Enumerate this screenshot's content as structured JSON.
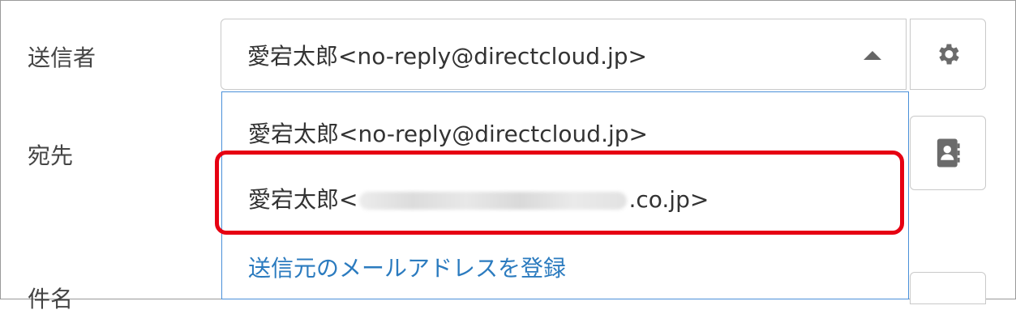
{
  "sender": {
    "label": "送信者",
    "selected": "愛宕太郎<no-reply@directcloud.jp>"
  },
  "recipient": {
    "label": "宛先"
  },
  "subject": {
    "label": "件名"
  },
  "dropdown": {
    "options": [
      {
        "text": "愛宕太郎<no-reply@directcloud.jp>"
      },
      {
        "prefix": "愛宕太郎<",
        "suffix": ".co.jp>"
      }
    ],
    "register_link": "送信元のメールアドレスを登録"
  },
  "colors": {
    "highlight": "#e60012",
    "link": "#2b7bbf",
    "focus_border": "#4a90d9"
  },
  "icons": {
    "settings": "gear-icon",
    "address_book": "address-book-icon"
  }
}
